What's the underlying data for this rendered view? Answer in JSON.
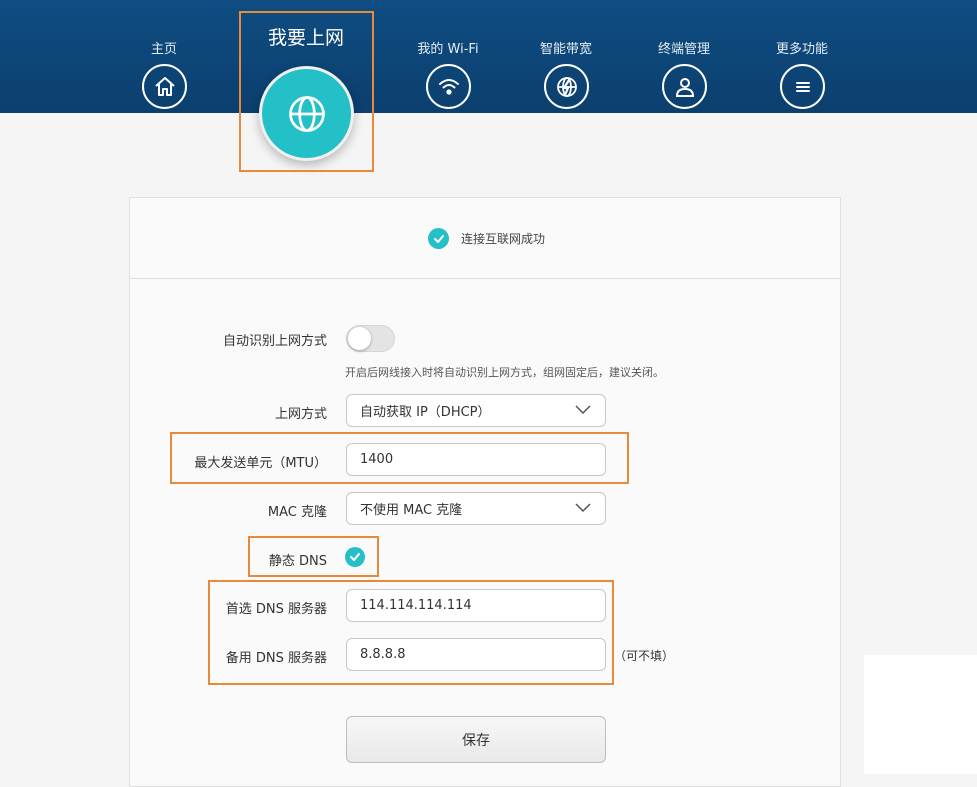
{
  "nav": {
    "items": [
      {
        "label": "主页",
        "icon": "home-icon"
      },
      {
        "label": "我要上网",
        "icon": "globe-icon",
        "active": true
      },
      {
        "label": "我的 Wi-Fi",
        "icon": "wifi-icon"
      },
      {
        "label": "智能带宽",
        "icon": "bandwidth-globe-icon"
      },
      {
        "label": "终端管理",
        "icon": "user-icon"
      },
      {
        "label": "更多功能",
        "icon": "menu-icon"
      }
    ]
  },
  "status": {
    "text": "连接互联网成功"
  },
  "form": {
    "auto_detect_label": "自动识别上网方式",
    "auto_detect_on": false,
    "auto_detect_hint": "开启后网线接入时将自动识别上网方式，组网固定后，建议关闭。",
    "mode_label": "上网方式",
    "mode_value": "自动获取 IP（DHCP）",
    "mtu_label": "最大发送单元（MTU）",
    "mtu_value": "1400",
    "mac_label": "MAC 克隆",
    "mac_value": "不使用 MAC 克隆",
    "static_dns_label": "静态 DNS",
    "static_dns_checked": true,
    "primary_dns_label": "首选 DNS 服务器",
    "primary_dns_value": "114.114.114.114",
    "secondary_dns_label": "备用 DNS 服务器",
    "secondary_dns_value": "8.8.8.8",
    "secondary_optional": "（可不填）",
    "save_label": "保存"
  },
  "colors": {
    "header": "#0f4d82",
    "accent": "#24c0c8",
    "highlight": "#e88a3a"
  }
}
